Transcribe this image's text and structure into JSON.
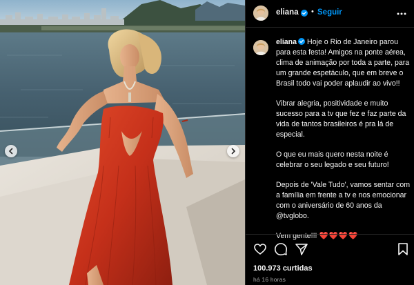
{
  "post": {
    "username": "eliana",
    "follow_label": "Seguir",
    "separator": "•",
    "caption_paragraphs": [
      "Vibrar alegria, positividade e muito sucesso para a tv que fez e faz parte da vida de tantos brasileiros é pra lá de especial.",
      "O que eu mais quero nesta noite é celebrar o seu legado e seu futuro!",
      "Depois de 'Vale Tudo', vamos sentar com a família em frente a tv e nos emocionar com o aniversário de 60 anos da @tvglobo."
    ],
    "caption_first": "Hoje o Rio de Janeiro parou para esta festa! Amigos na ponte aérea, clima de animação por toda a parte, para um grande espetáculo, que em breve o Brasil todo vai poder aplaudir ao vivo!!",
    "caption_last": "Vem gente!!!",
    "caption_hearts": "❤️❤️❤️❤️",
    "likes": "100.973 curtidas",
    "timestamp": "há 16 horas"
  },
  "icons": {
    "verified": "verified-badge-icon",
    "more": "more-options-icon",
    "like": "heart-icon",
    "comment": "comment-icon",
    "share": "send-icon",
    "save": "bookmark-icon",
    "prev": "chevron-left-icon",
    "next": "chevron-right-icon"
  },
  "colors": {
    "background": "#000000",
    "accent": "#0095f6",
    "dress": "#c8321c",
    "muted": "#a8a8a8"
  }
}
